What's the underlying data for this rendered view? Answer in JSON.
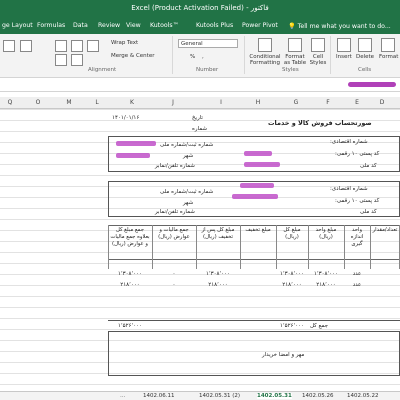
{
  "window": {
    "title": "Excel (Product Activation Failed) - فاکتور"
  },
  "tabs": [
    {
      "label": "ge Layout"
    },
    {
      "label": "Formulas"
    },
    {
      "label": "Data"
    },
    {
      "label": "Review"
    },
    {
      "label": "View"
    },
    {
      "label": "Kutools™"
    },
    {
      "label": "Kutools Plus"
    },
    {
      "label": "Power Pivot"
    },
    {
      "label": "Tell me what you want to do..."
    }
  ],
  "ribbon": {
    "wrap_text": "Wrap Text",
    "merge_center": "Merge & Center",
    "number_format": "General",
    "percent": "%",
    "comma": ",",
    "conditional_formatting": "Conditional Formatting",
    "format_as_table": "Format as Table",
    "cell_styles": "Cell Styles",
    "insert": "Insert",
    "delete": "Delete",
    "format": "Format",
    "group_alignment": "Alignment",
    "group_number": "Number",
    "group_styles": "Styles",
    "group_cells": "Cells"
  },
  "columns": [
    "Q",
    "P",
    "O",
    "N",
    "M",
    "L",
    "K",
    "J",
    "I",
    "H",
    "G",
    "F",
    "E",
    "D"
  ],
  "invoice": {
    "title": "صورتحساب فروش کالا و خدمات",
    "date_label": "تاریخ",
    "date_value": "۱۴۰۱/۰۱/۱۶",
    "number_label": "شماره",
    "seller": {
      "economic_code": "شماره اقتصادی:",
      "national_id": "شماره ثبت/شماره ملی",
      "city": "شهر",
      "postal_code": "کد پستی ۱۰ رقمی:",
      "phone": "شماره تلفن/نمابر",
      "address": "کد ملی"
    },
    "buyer": {
      "economic_code": "شماره اقتصادی:",
      "national_id": "شماره ثبت/شماره ملی",
      "city": "شهر",
      "postal_code": "کد پستی ۱۰ رقمی:",
      "phone": "شماره تلفن/نمابر",
      "address": "کد ملی"
    },
    "headers": {
      "total": "جمع مبلغ کل بعلاوه جمع مالیات و عوارض (ریال)",
      "tax": "جمع مالیات و عوارض (ریال)",
      "after_discount": "مبلغ کل پس از تخفیف (ریال)",
      "discount": "مبلغ تخفیف",
      "gross": "مبلغ کل (ریال)",
      "unit_price": "مبلغ واحد (ریال)",
      "unit": "واحد اندازه گیری",
      "qty": "تعداد/مقدار"
    },
    "rows": [
      {
        "total": "۱٬۳۰۸٬۰۰۰",
        "tax": "۰",
        "after_discount": "۱٬۳۰۸٬۰۰۰",
        "discount": "",
        "gross": "۱٬۳۰۸٬۰۰۰",
        "unit_price": "۱٬۳۰۸٬۰۰۰",
        "unit": "عدد"
      },
      {
        "total": "۲۱۸٬۰۰۰",
        "tax": "۰",
        "after_discount": "۲۱۸٬۰۰۰",
        "discount": "",
        "gross": "۲۱۸٬۰۰۰",
        "unit_price": "۲۱۸٬۰۰۰",
        "unit": "عدد"
      }
    ],
    "sum_label": "جمع کل",
    "sum_value": "۱٬۵۲۶٬۰۰۰",
    "sum_total": "۱٬۵۲۶٬۰۰۰",
    "stamp_label": "مهر و امضا خریدار"
  },
  "sheet_tabs": [
    "1402.06.11",
    "1402.05.31 (2)",
    "1402.05.31",
    "1402.05.26",
    "1402.05.22"
  ],
  "active_sheet": "1402.05.31 (2)",
  "colors": {
    "accent": "#217346",
    "blur": "#c050c8"
  }
}
